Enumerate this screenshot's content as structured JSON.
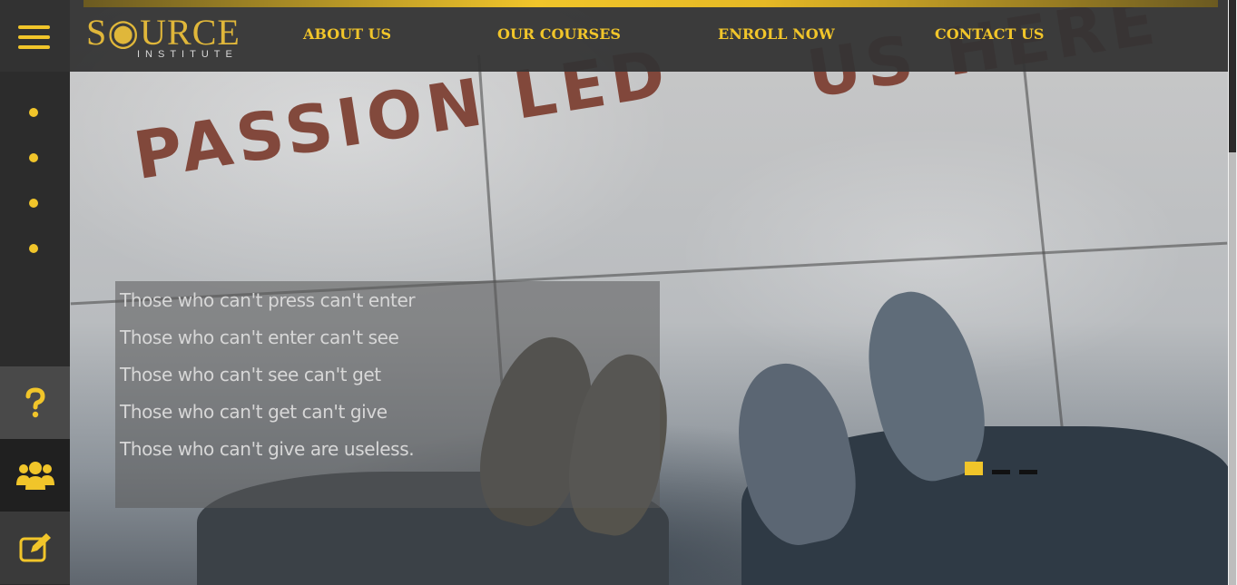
{
  "brand": {
    "logo_main": "S◉URCE",
    "logo_sub": "INSTITUTE",
    "accent_color": "#f1c52a"
  },
  "nav": {
    "menu_icon": "hamburger-icon",
    "items": [
      {
        "label": "ABOUT US"
      },
      {
        "label": "OUR COURSES"
      },
      {
        "label": "ENROLL NOW"
      },
      {
        "label": "CONTACT US"
      }
    ]
  },
  "sidebar": {
    "dots": 4,
    "buttons": [
      {
        "icon": "question-icon"
      },
      {
        "icon": "users-icon"
      },
      {
        "icon": "edit-icon"
      }
    ]
  },
  "hero": {
    "stamp_text_1": "PASSION LED",
    "stamp_text_2": "US HERE",
    "quote_lines": [
      "Those who can't press can't enter",
      "Those who can't enter can't see",
      "Those who can't see can't get",
      "Those who can't get can't give",
      "Those who can't give are useless."
    ],
    "slides": {
      "total": 3,
      "active": 1
    }
  }
}
